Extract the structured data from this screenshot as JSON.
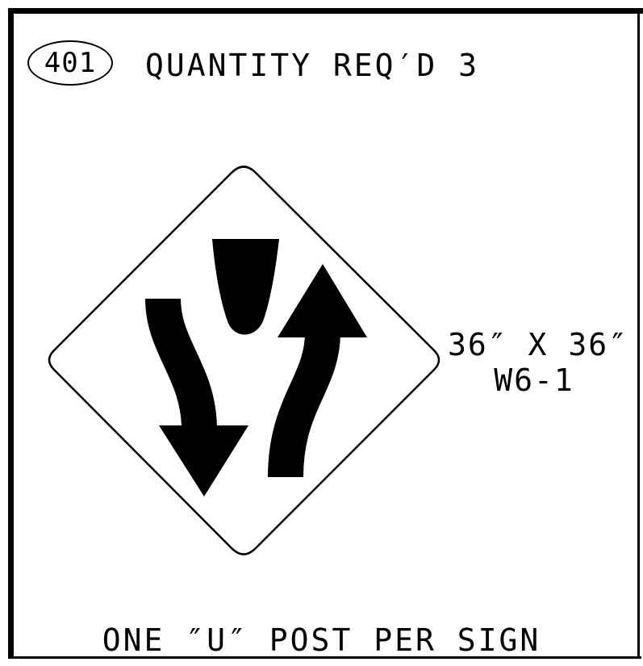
{
  "header": {
    "sign_number": "401",
    "quantity_text": "QUANTITY REQ′D 3"
  },
  "sign": {
    "size": "36″ X 36″",
    "code": "W6-1",
    "symbol": "divided-highway-begins-icon"
  },
  "footer": {
    "post_note": "ONE ″U″ POST PER SIGN"
  }
}
